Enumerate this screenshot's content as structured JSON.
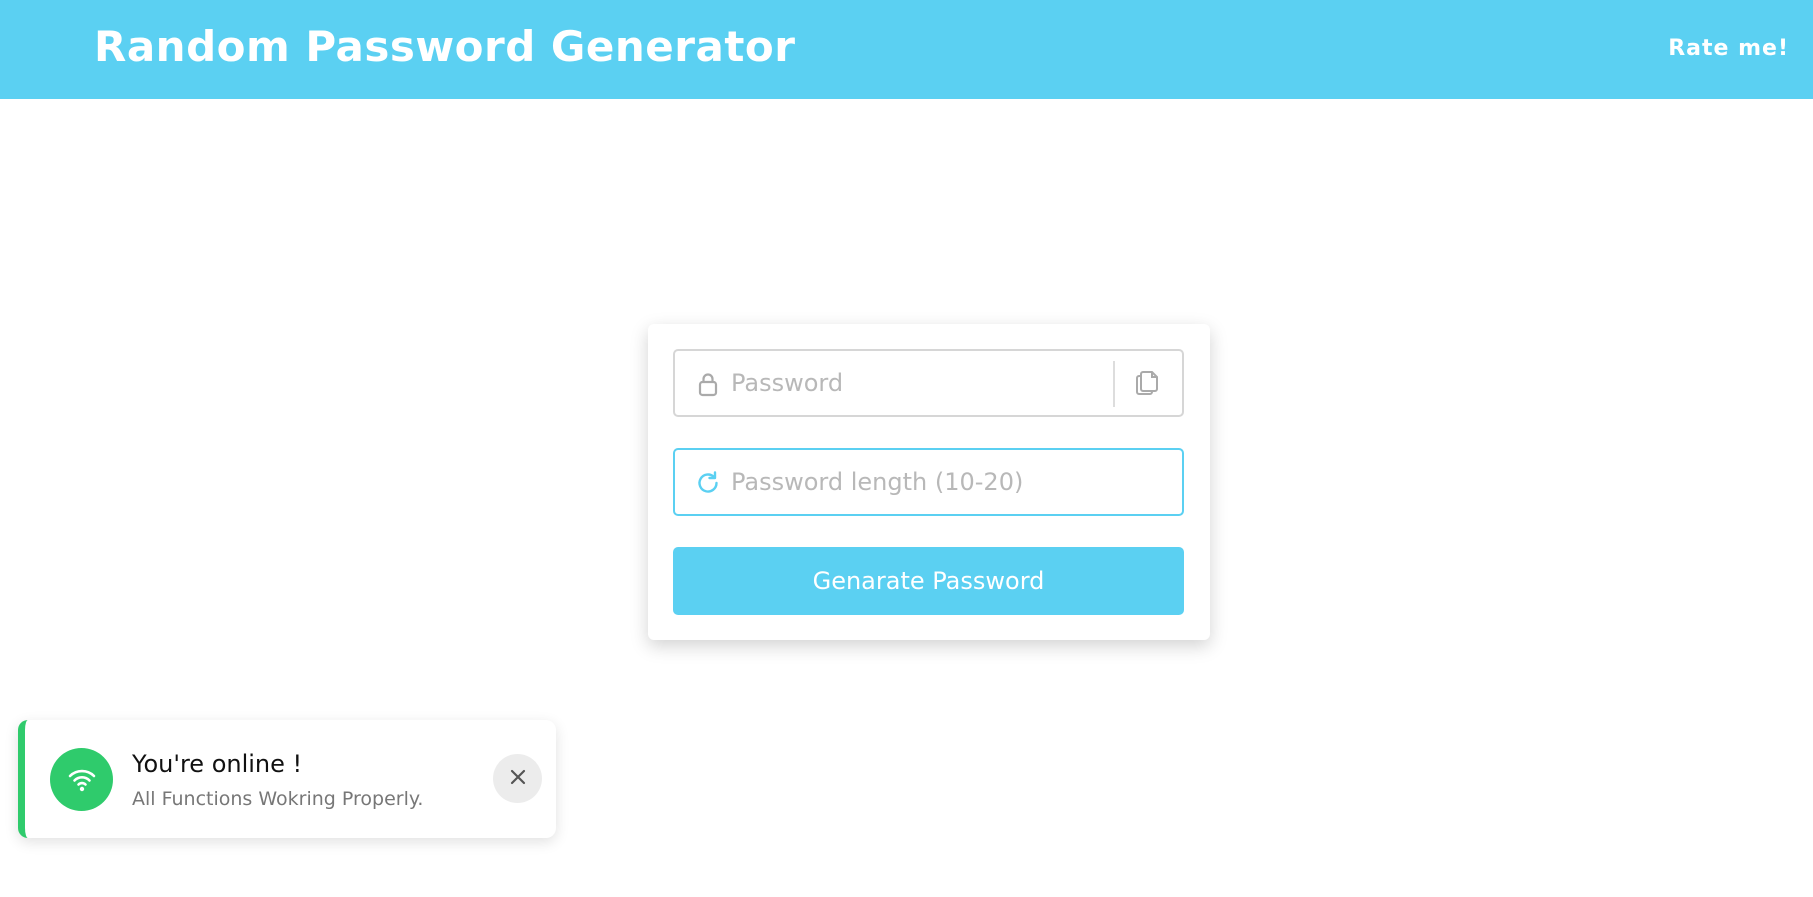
{
  "header": {
    "title": "Random Password Generator",
    "rate_link": "Rate me!",
    "color": "#5bd0f2"
  },
  "form": {
    "password_field": {
      "placeholder": "Password",
      "value": "",
      "icon": "lock-icon",
      "action_icon": "copy-icon"
    },
    "length_field": {
      "placeholder": "Password length (10-20)",
      "value": "",
      "icon": "refresh-icon"
    },
    "generate_button": "Genarate Password"
  },
  "toast": {
    "title": "You're online !",
    "message": "All Functions Wokring Properly.",
    "icon": "wifi-icon",
    "accent_color": "#2fcb6c"
  }
}
